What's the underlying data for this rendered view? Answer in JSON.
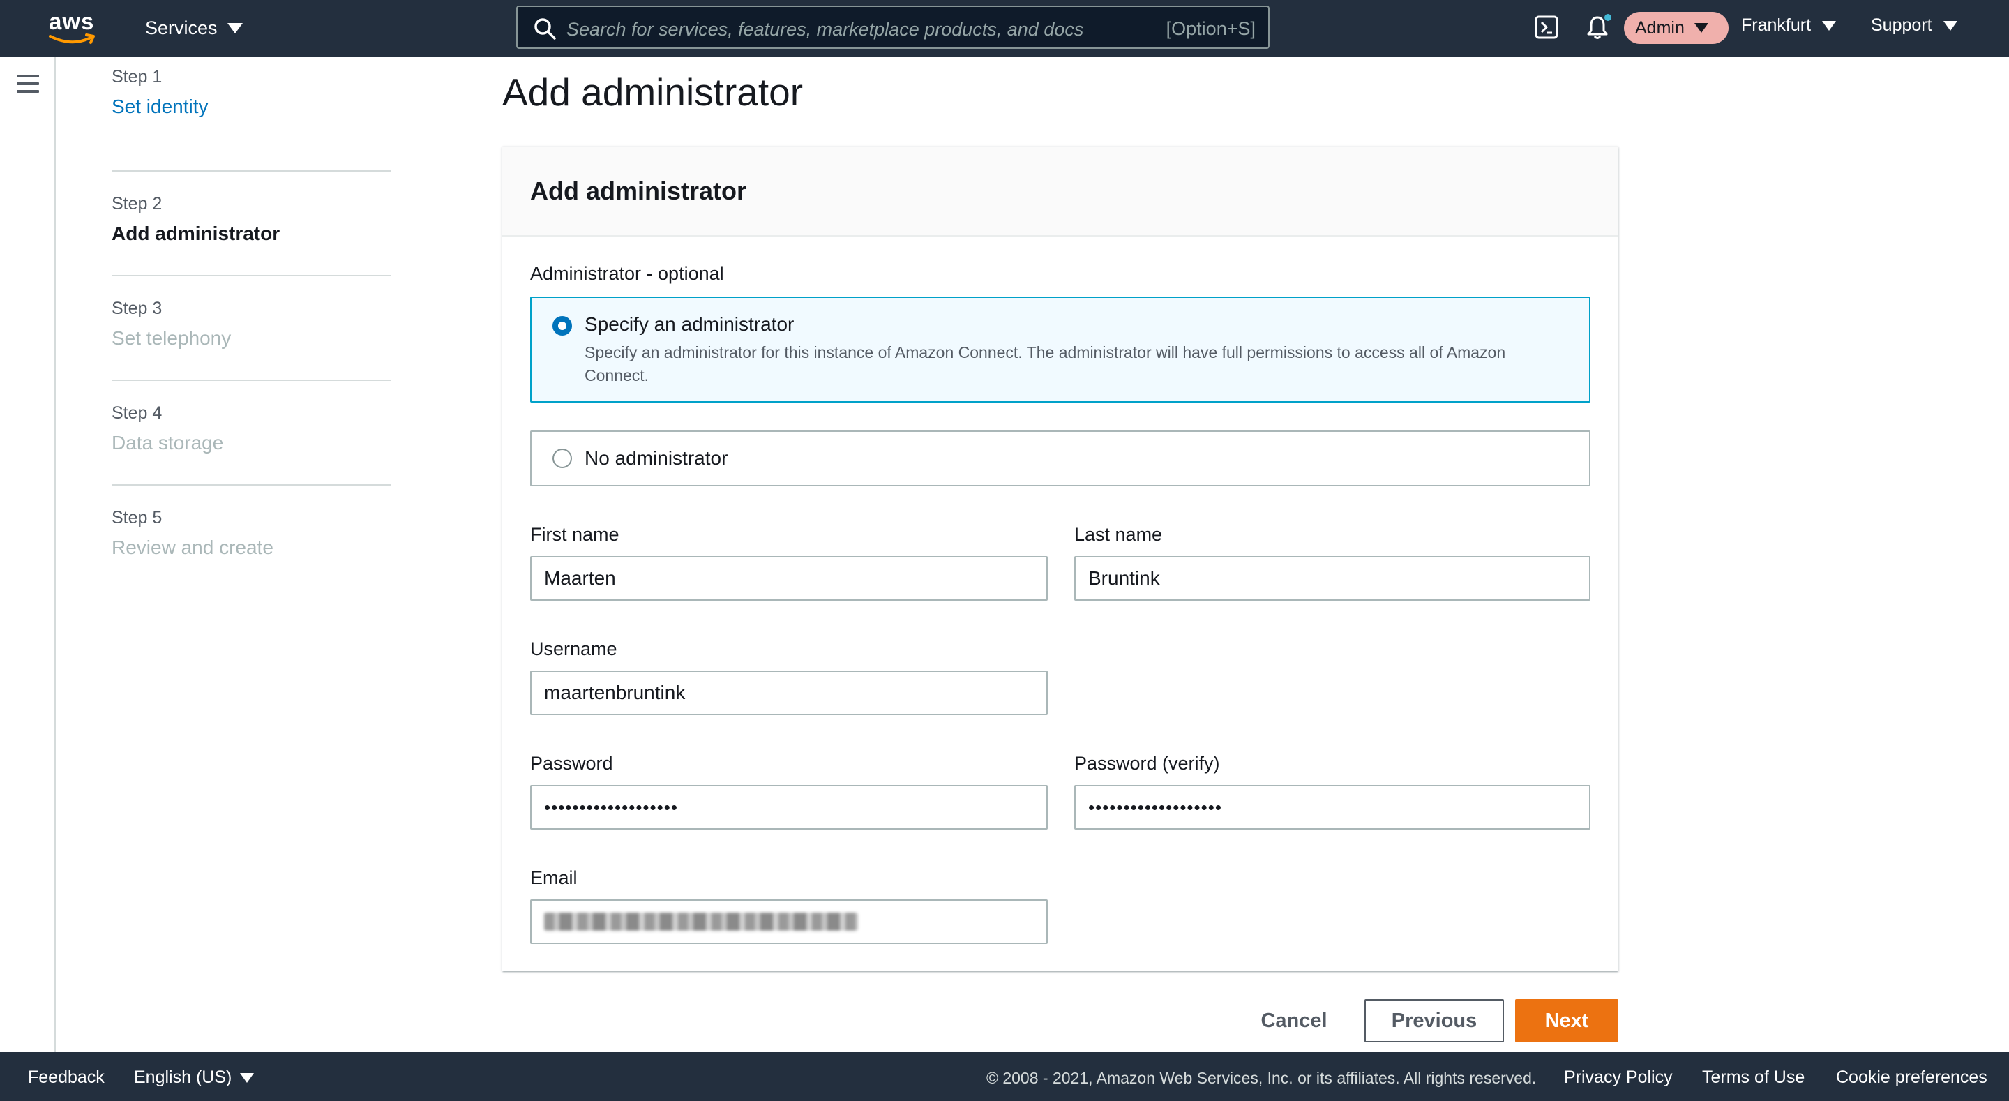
{
  "topnav": {
    "logo_text": "aws",
    "services_label": "Services",
    "search_placeholder": "Search for services, features, marketplace products, and docs",
    "search_shortcut": "[Option+S]",
    "account_label": "Admin",
    "region_label": "Frankfurt",
    "support_label": "Support",
    "notification_dot_color": "#44b9d6"
  },
  "steps": [
    {
      "num": "Step 1",
      "label": "Set identity",
      "state": "link"
    },
    {
      "num": "Step 2",
      "label": "Add administrator",
      "state": "current"
    },
    {
      "num": "Step 3",
      "label": "Set telephony",
      "state": "disabled"
    },
    {
      "num": "Step 4",
      "label": "Data storage",
      "state": "disabled"
    },
    {
      "num": "Step 5",
      "label": "Review and create",
      "state": "disabled"
    }
  ],
  "page_title": "Add administrator",
  "container": {
    "header": "Add administrator",
    "admin_group_label": "Administrator - optional",
    "option_specify": {
      "title": "Specify an administrator",
      "description": "Specify an administrator for this instance of Amazon Connect. The administrator will have full permissions to access all of Amazon Connect.",
      "selected": true
    },
    "option_none": {
      "title": "No administrator",
      "selected": false
    },
    "fields": {
      "first_name_label": "First name",
      "first_name_value": "Maarten",
      "last_name_label": "Last name",
      "last_name_value": "Bruntink",
      "username_label": "Username",
      "username_value": "maartenbruntink",
      "password_label": "Password",
      "password_value": "•••••••••••••••••••",
      "password_verify_label": "Password (verify)",
      "password_verify_value": "•••••••••••••••••••",
      "email_label": "Email"
    }
  },
  "actions": {
    "cancel": "Cancel",
    "previous": "Previous",
    "next": "Next",
    "next_color": "#ec7211"
  },
  "footer": {
    "feedback": "Feedback",
    "language": "English (US)",
    "copyright": "© 2008 - 2021, Amazon Web Services, Inc. or its affiliates. All rights reserved.",
    "privacy": "Privacy Policy",
    "terms": "Terms of Use",
    "cookies": "Cookie preferences"
  }
}
